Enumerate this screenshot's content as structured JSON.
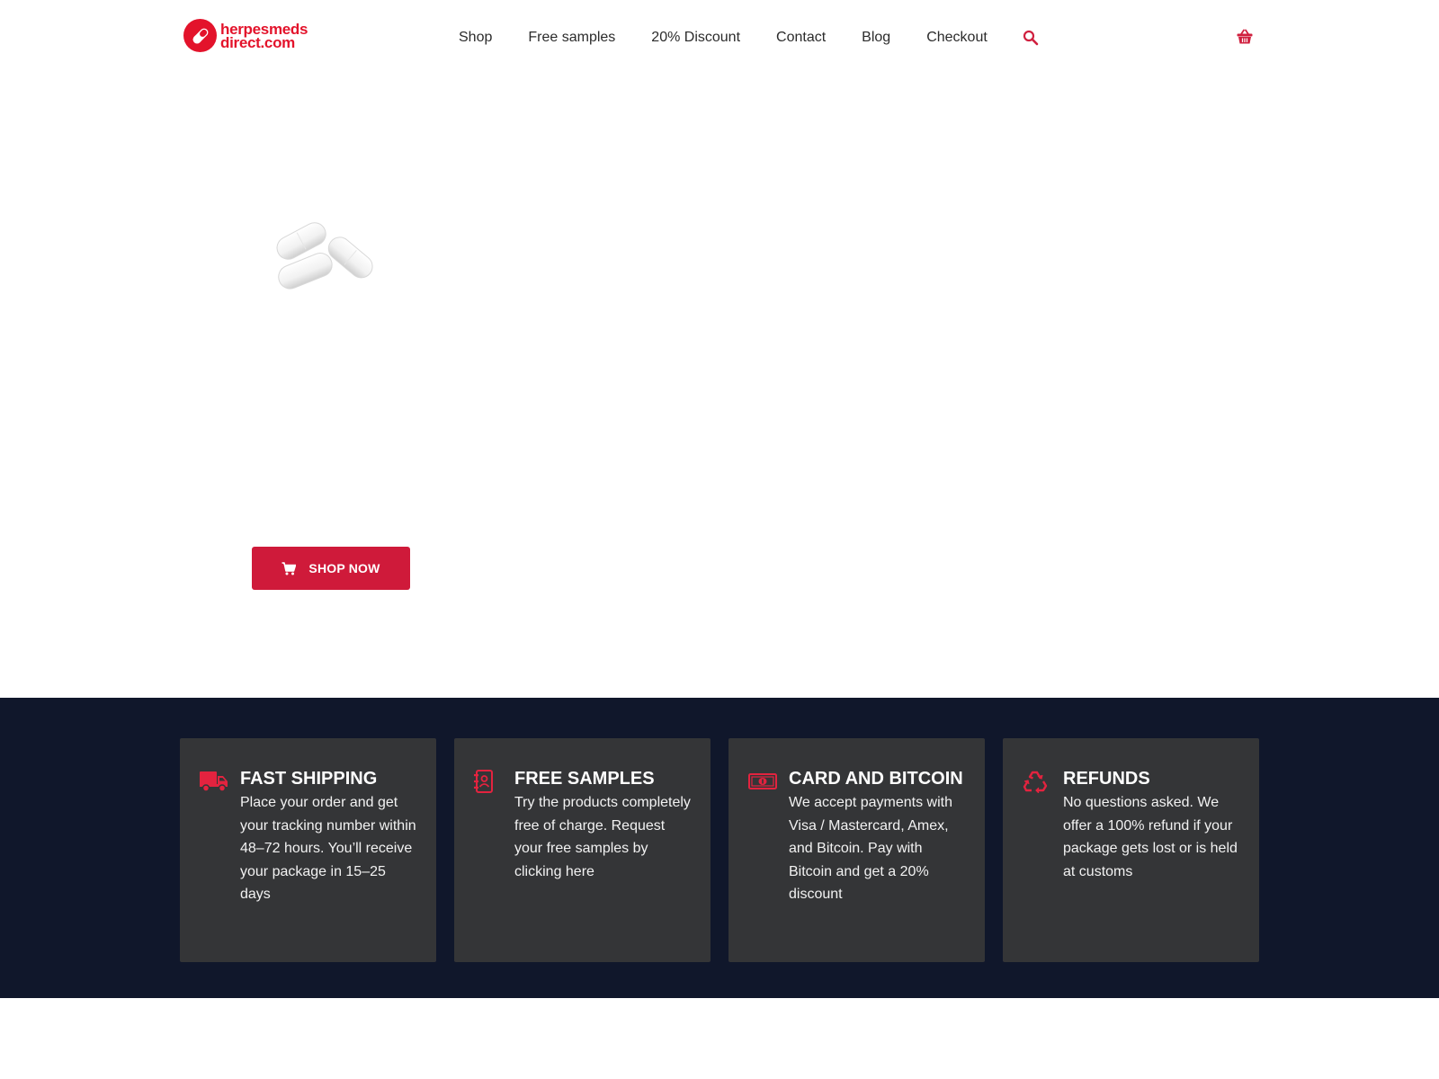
{
  "brand": {
    "line1": "herpesmeds",
    "line2": "direct.com",
    "color": "#e3132b"
  },
  "nav": {
    "items": [
      {
        "label": "Shop"
      },
      {
        "label": "Free samples"
      },
      {
        "label": "20% Discount"
      },
      {
        "label": "Contact"
      },
      {
        "label": "Blog"
      },
      {
        "label": "Checkout"
      }
    ],
    "search_icon": "search-icon",
    "cart_icon": "basket-icon"
  },
  "hero": {
    "image": "pills-image",
    "shop_button_label": "SHOP NOW",
    "shop_button_icon": "cart-icon",
    "button_color": "#cf1a3a"
  },
  "features": {
    "background": "#10172b",
    "card_color": "#343537",
    "cards": [
      {
        "icon": "truck-icon",
        "title": "FAST SHIPPING",
        "text": "Place your order and get your tracking number within 48–72 hours. You’ll receive your package in 15–25 days"
      },
      {
        "icon": "contact-book-icon",
        "title": "FREE SAMPLES",
        "text": "Try the products completely free of charge. Request your free samples by clicking here"
      },
      {
        "icon": "money-bill-icon",
        "title": "CARD AND BITCOIN",
        "text": "We accept payments with Visa / Mastercard, Amex, and Bitcoin. Pay with Bitcoin and get a 20% discount"
      },
      {
        "icon": "recycle-icon",
        "title": "REFUNDS",
        "text": "No questions asked. We offer a 100% refund if your package gets lost or is held at customs"
      }
    ]
  }
}
